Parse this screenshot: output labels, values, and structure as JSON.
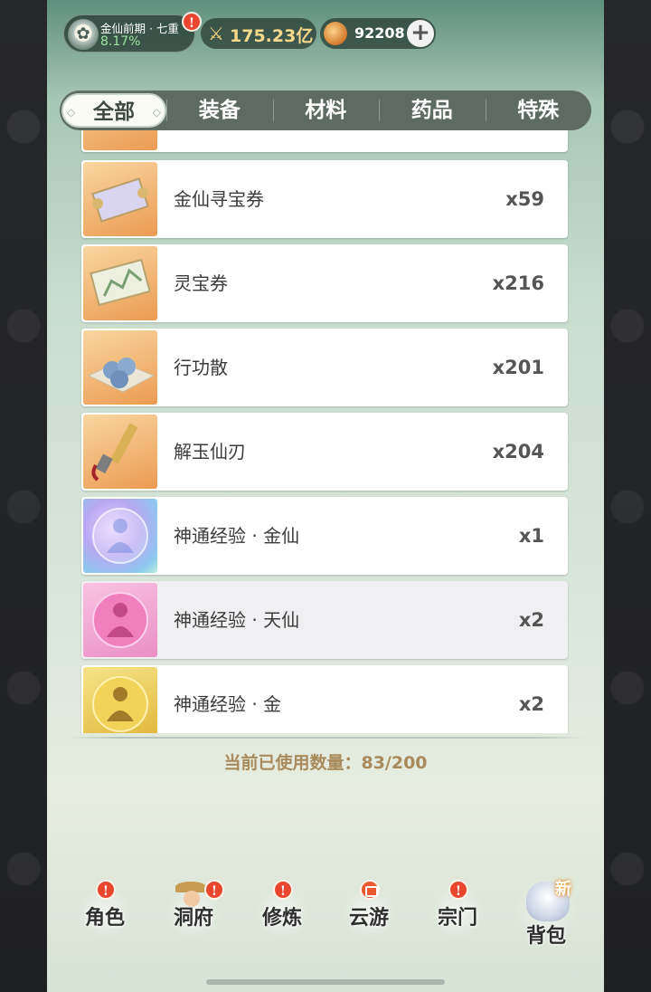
{
  "header": {
    "realm_name": "金仙前期 · 七重",
    "realm_progress": "8.17%",
    "power_value": "175.23亿",
    "coins_value": "92208",
    "alert_mark": "!"
  },
  "tabs": [
    {
      "label": "全部",
      "active": true
    },
    {
      "label": "装备",
      "active": false
    },
    {
      "label": "材料",
      "active": false
    },
    {
      "label": "药品",
      "active": false
    },
    {
      "label": "特殊",
      "active": false
    }
  ],
  "items": [
    {
      "name": "金仙寻宝券",
      "qty": "x59",
      "icon": "treasure-map-scroll-icon"
    },
    {
      "name": "灵宝券",
      "qty": "x216",
      "icon": "landscape-scroll-icon"
    },
    {
      "name": "行功散",
      "qty": "x201",
      "icon": "blue-pills-icon"
    },
    {
      "name": "解玉仙刃",
      "qty": "x204",
      "icon": "jade-blade-icon"
    },
    {
      "name": "神通经验 · 金仙",
      "qty": "x1",
      "icon": "purple-orb-icon"
    },
    {
      "name": "神通经验 · 天仙",
      "qty": "x2",
      "icon": "pink-orb-icon"
    },
    {
      "name": "神通经验 · 金",
      "qty": "x2",
      "icon": "gold-orb-icon"
    }
  ],
  "capacity_text": "当前已使用数量：83/200",
  "nav": {
    "items": [
      {
        "label": "角色",
        "badge": "!"
      },
      {
        "label": "洞府",
        "badge": "!"
      },
      {
        "label": "修炼",
        "badge": "!"
      },
      {
        "label": "云游",
        "badge": "event"
      },
      {
        "label": "宗门",
        "badge": "!"
      },
      {
        "label": "背包",
        "badge": "新"
      }
    ]
  },
  "colors": {
    "accent_gold": "#a88a5b",
    "alert_red": "#e9462f",
    "tab_bar": "#5e6b63",
    "realm_progress": "#9be3a0"
  }
}
